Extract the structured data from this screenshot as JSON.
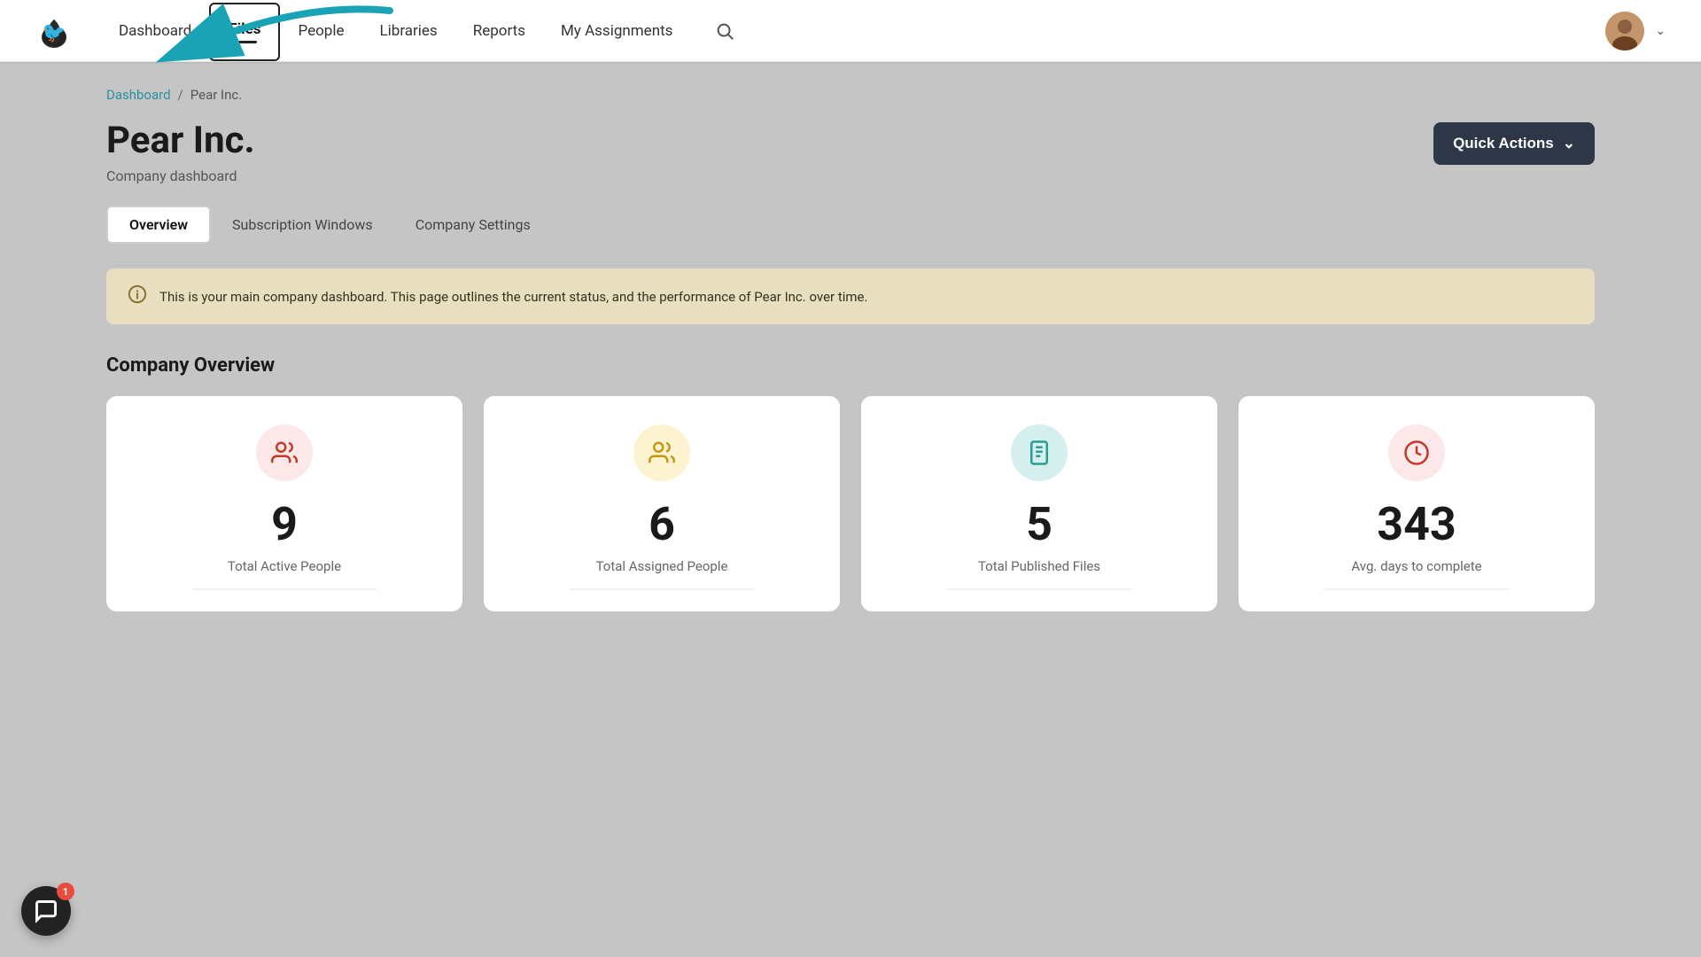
{
  "brand": {
    "logo_symbol": "🍐"
  },
  "nav": {
    "items": [
      {
        "id": "dashboard",
        "label": "Dashboard",
        "active": false
      },
      {
        "id": "files",
        "label": "Files",
        "active": true
      },
      {
        "id": "people",
        "label": "People"
      },
      {
        "id": "libraries",
        "label": "Libraries"
      },
      {
        "id": "reports",
        "label": "Reports"
      },
      {
        "id": "my_assignments",
        "label": "My Assignments"
      }
    ],
    "quick_actions_label": "Quick Actions",
    "chevron": "⌄"
  },
  "breadcrumb": {
    "home": "Dashboard",
    "separator": "/",
    "current": "Pear Inc."
  },
  "page": {
    "title": "Pear Inc.",
    "subtitle": "Company dashboard",
    "quick_actions_btn": "Quick Actions",
    "quick_actions_chevron": "⌄"
  },
  "tabs": [
    {
      "id": "overview",
      "label": "Overview",
      "active": true
    },
    {
      "id": "subscription_windows",
      "label": "Subscription Windows",
      "active": false
    },
    {
      "id": "company_settings",
      "label": "Company Settings",
      "active": false
    }
  ],
  "info_banner": {
    "text": "This is your main company dashboard. This page outlines the current status, and the performance of Pear Inc. over time."
  },
  "company_overview": {
    "section_title": "Company Overview",
    "stats": [
      {
        "id": "active_people",
        "value": "9",
        "label": "Total Active People",
        "icon_type": "red",
        "icon": "👥"
      },
      {
        "id": "assigned_people",
        "value": "6",
        "label": "Total Assigned People",
        "icon_type": "yellow",
        "icon": "👥"
      },
      {
        "id": "published_files",
        "value": "5",
        "label": "Total Published Files",
        "icon_type": "teal",
        "icon": "📋"
      },
      {
        "id": "avg_days",
        "value": "343",
        "label": "Avg. days to complete",
        "icon_type": "red2",
        "icon": "🕐"
      }
    ]
  },
  "notification": {
    "count": "1"
  }
}
